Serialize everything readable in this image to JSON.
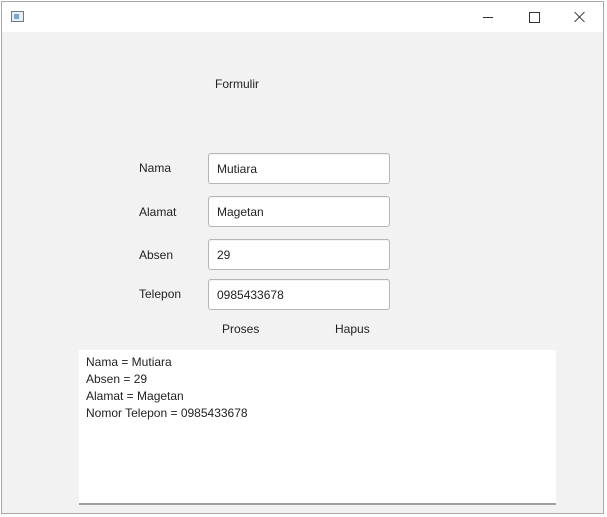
{
  "window": {
    "title": "",
    "icon": "java-app-icon",
    "controls": [
      "minimize-icon",
      "maximize-icon",
      "close-icon"
    ]
  },
  "form": {
    "title": "Formulir",
    "fields": [
      {
        "label": "Nama",
        "value": "Mutiara"
      },
      {
        "label": "Alamat",
        "value": "Magetan"
      },
      {
        "label": "Absen",
        "value": "29"
      },
      {
        "label": "Telepon",
        "value": "0985433678"
      }
    ],
    "buttons": {
      "proses": "Proses",
      "hapus": "Hapus"
    }
  },
  "output": {
    "lines": [
      "Nama = Mutiara",
      "Absen = 29",
      "Alamat = Magetan",
      "Nomor Telepon = 0985433678"
    ]
  }
}
